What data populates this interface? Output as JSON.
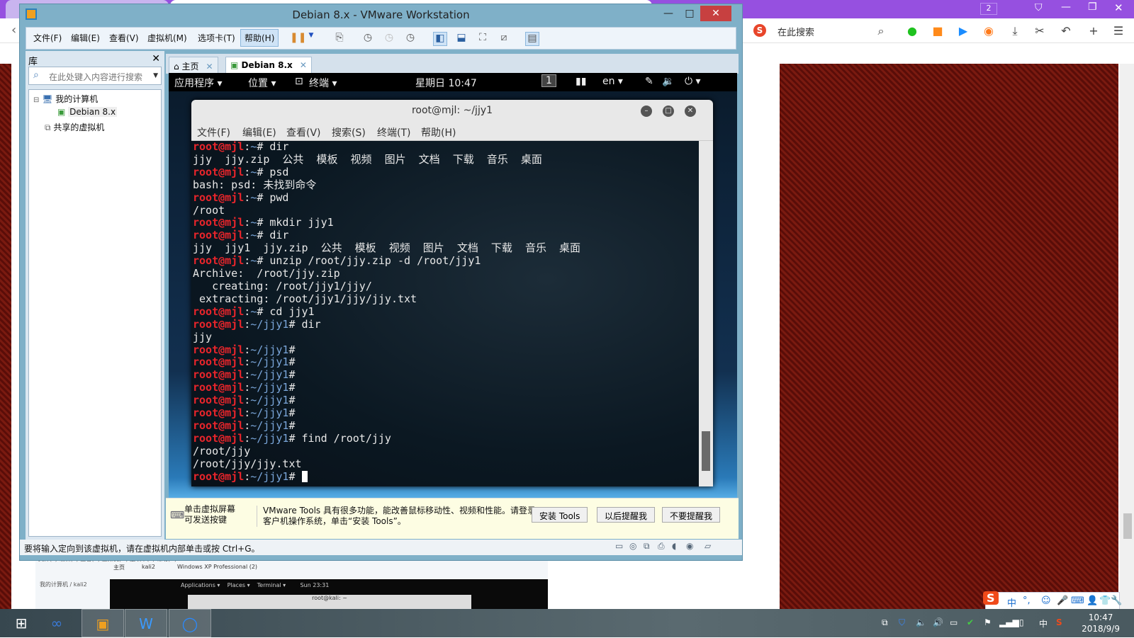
{
  "browser": {
    "tab_count": "2",
    "search_placeholder": "在此搜索",
    "colors": {
      "bar": "#9650e0"
    },
    "icons": [
      "search-icon",
      "wechat-icon",
      "video-icon",
      "play-icon",
      "game-icon",
      "download-icon",
      "scissors-icon",
      "undo-icon",
      "plus-icon",
      "menu-icon"
    ]
  },
  "vmware": {
    "title": "Debian 8.x - VMware Workstation",
    "menu": [
      "文件(F)",
      "编辑(E)",
      "查看(V)",
      "虚拟机(M)",
      "选项卡(T)",
      "帮助(H)"
    ],
    "library": {
      "title": "库",
      "search_placeholder": "在此处键入内容进行搜索",
      "tree": [
        "我的计算机",
        "Debian 8.x",
        "共享的虚拟机"
      ]
    },
    "tabs": [
      {
        "label": "主页"
      },
      {
        "label": "Debian 8.x",
        "active": true
      }
    ],
    "notice": {
      "left": "单击虚拟屏幕\n可发送按键",
      "text1": "VMware Tools 具有很多功能，能改善鼠标移动性、视频和性能。请登录",
      "text2": "客户机操作系统，单击“安装 Tools”。",
      "buttons": [
        "安装 Tools",
        "以后提醒我",
        "不要提醒我"
      ]
    },
    "status": "要将输入定向到该虚拟机，请在虚拟机内部单击或按 Ctrl+G。"
  },
  "guest": {
    "topbar": {
      "apps": "应用程序 ▾",
      "places": "位置 ▾",
      "terminal": "终端 ▾",
      "clock": "星期日 10:47",
      "workspace": "1",
      "lang": "en ▾"
    },
    "terminal": {
      "title": "root@mjl: ~/jjy1",
      "menu": [
        "文件(F)",
        "编辑(E)",
        "查看(V)",
        "搜索(S)",
        "终端(T)",
        "帮助(H)"
      ],
      "prompt_user": "root@mjl",
      "lines": [
        {
          "path": "~",
          "cmd": " dir"
        },
        {
          "text": "jjy  jjy.zip  公共  模板  视频  图片  文档  下载  音乐  桌面"
        },
        {
          "path": "~",
          "cmd": " psd"
        },
        {
          "text": "bash: psd: 未找到命令"
        },
        {
          "path": "~",
          "cmd": " pwd"
        },
        {
          "text": "/root"
        },
        {
          "path": "~",
          "cmd": " mkdir jjy1"
        },
        {
          "path": "~",
          "cmd": " dir"
        },
        {
          "text": "jjy  jjy1  jjy.zip  公共  模板  视频  图片  文档  下载  音乐  桌面"
        },
        {
          "path": "~",
          "cmd": " unzip /root/jjy.zip -d /root/jjy1"
        },
        {
          "text": "Archive:  /root/jjy.zip"
        },
        {
          "text": "   creating: /root/jjy1/jjy/"
        },
        {
          "text": " extracting: /root/jjy1/jjy/jjy.txt"
        },
        {
          "path": "~",
          "cmd": " cd jjy1"
        },
        {
          "path": "~/jjy1",
          "cmd": " dir"
        },
        {
          "text": "jjy"
        },
        {
          "path": "~/jjy1",
          "cmd": ""
        },
        {
          "path": "~/jjy1",
          "cmd": ""
        },
        {
          "path": "~/jjy1",
          "cmd": ""
        },
        {
          "path": "~/jjy1",
          "cmd": ""
        },
        {
          "path": "~/jjy1",
          "cmd": ""
        },
        {
          "path": "~/jjy1",
          "cmd": ""
        },
        {
          "path": "~/jjy1",
          "cmd": ""
        },
        {
          "path": "~/jjy1",
          "cmd": " find /root/jjy"
        },
        {
          "text": "/root/jjy"
        },
        {
          "text": "/root/jjy/jjy.txt"
        },
        {
          "path": "~/jjy1",
          "cmd": " ",
          "cursor": true
        }
      ]
    }
  },
  "ghost": {
    "menu": "文件(F)  编辑(E)  查看(V)  虚拟机(M)  选项卡(T)  帮助(H)",
    "tabs": [
      "主页",
      "kali2",
      "Windows XP Professional (2)"
    ],
    "topbar": "Applications ▾    Places ▾    Terminal ▾        Sun 23:31",
    "term_title": "root@kali: ~",
    "tree": "我的计算机 / kali2"
  },
  "taskbar": {
    "time": "10:47",
    "date": "2018/9/9",
    "ime_lang": "中"
  },
  "ime_bar": {
    "lang": "中",
    "punct": "°,"
  }
}
